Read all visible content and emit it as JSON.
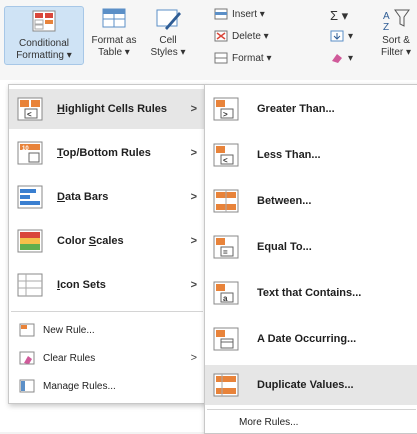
{
  "ribbon": {
    "conditional_formatting": "Conditional\nFormatting ▾",
    "format_as_table": "Format as\nTable ▾",
    "cell_styles": "Cell\nStyles ▾",
    "insert": "Insert  ▾",
    "delete": "Delete  ▾",
    "format": "Format ▾",
    "autosum": "Σ ▾",
    "fill": "▾",
    "clear": "▾",
    "sort_filter": "Sort &\nFilter ▾"
  },
  "cf_menu": {
    "items": [
      {
        "label": "Highlight Cells Rules",
        "underline": "H",
        "rest": "ighlight Cells Rules"
      },
      {
        "label": "Top/Bottom Rules",
        "underline": "T",
        "rest": "op/Bottom Rules"
      },
      {
        "label": "Data Bars",
        "underline": "D",
        "rest": "ata Bars"
      },
      {
        "label": "Color Scales",
        "underline": "S",
        "rest": "Color Scales"
      },
      {
        "label": "Icon Sets",
        "underline": "I",
        "rest": "con Sets"
      }
    ],
    "new_rule": "New Rule...",
    "clear_rules": "Clear Rules",
    "manage_rules": "Manage Rules..."
  },
  "sub_menu": {
    "items": [
      {
        "label": "Greater Than..."
      },
      {
        "label": "Less Than..."
      },
      {
        "label": "Between..."
      },
      {
        "label": "Equal To..."
      },
      {
        "label": "Text that Contains..."
      },
      {
        "label": "A Date Occurring..."
      },
      {
        "label": "Duplicate Values..."
      }
    ],
    "more_rules": "More Rules..."
  },
  "colors": {
    "accent": "#1f6fc5",
    "highlight": "#e6e6e6",
    "orange": "#e8833a",
    "red": "#d9473b"
  }
}
